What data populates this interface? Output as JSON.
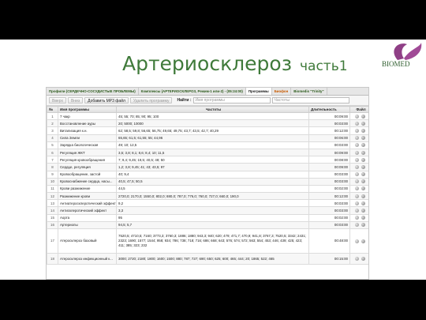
{
  "slide": {
    "title_main": "Артериосклероз",
    "title_sub": "часть1",
    "logo_text": "BIOMED"
  },
  "tabs": [
    {
      "label": "Профили (СЕРДЕЧНО-СОСУДИСТЫЕ ПРОБЛЕМЫ)",
      "state": "normal"
    },
    {
      "label": "Комплексы (АРТЕРИОСКЛЕРОЗ, Режим-1 или-2) - (05:24:00)",
      "state": "normal"
    },
    {
      "label": "Программы",
      "state": "active"
    },
    {
      "label": "Биофон",
      "state": "orange"
    },
    {
      "label": "Biomedis \"Trinity\"",
      "state": "normal"
    }
  ],
  "toolbar": {
    "btn_open": "Вверх",
    "btn_down": "Вниз",
    "btn_add_mp3": "Добавить MP3 файл",
    "btn_delete": "Удалить программу",
    "find_label": "Найти :",
    "search_placeholder_1": "Имя программы",
    "search_placeholder_2": "Частоты"
  },
  "table": {
    "headers": [
      "№",
      "Имя программы",
      "Частоты",
      "Длительность",
      "Файл"
    ],
    "rows": [
      {
        "n": "1",
        "name": "7 чакр",
        "freq": "45; 55; 70; 85; 90; 95; 100",
        "dur": "00:09:00"
      },
      {
        "n": "2",
        "name": "Восстановление ауры",
        "freq": "20; 5000; 10000",
        "dur": "00:03:00"
      },
      {
        "n": "3",
        "name": "Витализация к.н.",
        "freq": "62; 58,5; 59,8; 56,65; 56,75; 49,65; 49,75; 43,7; 43,5; 42,7; 40,29",
        "dur": "00:12:00"
      },
      {
        "n": "4",
        "name": "Сила Земли",
        "freq": "65,65; 61,5; 61,55; 55; 44,96",
        "dur": "00:06:00"
      },
      {
        "n": "5",
        "name": "Зарядка биологическая",
        "freq": "49; 10; 12,5",
        "dur": "00:03:00"
      },
      {
        "n": "6",
        "name": "Регуляция ЖКТ",
        "freq": "3,5; 3,8; 8,1; 8,6; 8,4; 10; 11,5",
        "dur": "00:09:00"
      },
      {
        "n": "7",
        "name": "Регуляция кровообращения",
        "freq": "7; 9,4; 9,45; 19,5; 40,5; 48; 50",
        "dur": "00:08:00"
      },
      {
        "n": "8",
        "name": "Сердце, регуляция",
        "freq": "1,2; 3,8; 9,45; 41; 43; 43,5; 97",
        "dur": "00:09:00"
      },
      {
        "n": "9",
        "name": "Кровообращение, застой",
        "freq": "40; 9,4",
        "dur": "00:03:00"
      },
      {
        "n": "10",
        "name": "Кровоснабжение сердца, насы...",
        "freq": "40,5; 47,5; 50,5",
        "dur": "00:03:00"
      },
      {
        "n": "11",
        "name": "Крови разжижение",
        "freq": "44,5",
        "dur": "00:02:00"
      },
      {
        "n": "12",
        "name": "Разжижение крови",
        "freq": "2720,0; 2170,0; 1550,0; 802,0; 880,0; 787,0; 776,0; 760,0; 727,0; 660,0; 190,0",
        "dur": "00:12:00"
      },
      {
        "n": "13",
        "name": "Антиатеросклеротический эффект",
        "freq": "9,2",
        "dur": "00:03:00"
      },
      {
        "n": "14",
        "name": "Антисклеротический эффект",
        "freq": "3,3",
        "dur": "00:03:00"
      },
      {
        "n": "15",
        "name": "Аорта",
        "freq": "95",
        "dur": "00:02:00"
      },
      {
        "n": "16",
        "name": "Артериолы",
        "freq": "94,5; 5,7",
        "dur": "00:03:00"
      },
      {
        "n": "17",
        "name": "Атеросклероз  базовый",
        "freq": "7520,5; 4710,5; 7160; 3773,3; 3760,3; 1886; 1880; 943,3; 940; 620; 479; 471,7; 470,9; 941,8; 3767,3; 7520,5; 3342; 2431; 2323; 1690; 1577; 1544; 958; 934; 786; 738; 718; 716; 686; 668; 643; 576; 574; 572; 563; 554; 453; 446; 439; 425; 423; 411; 385; 323; 232",
        "dur": "00:48:00"
      },
      {
        "n": "18",
        "name": "Атеросклероз  инфекционный к...",
        "freq": "3000; 2720; 2180; 1800; 1600; 1500; 880; 787; 727; 690; 650; 625; 600; 465; 444; 20; 1865; 522; 465",
        "dur": "00:15:00"
      }
    ]
  }
}
